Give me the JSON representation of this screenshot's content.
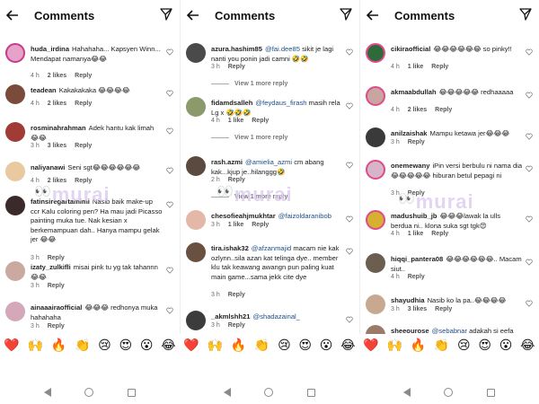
{
  "header": {
    "title": "Comments"
  },
  "watermark": "murai",
  "panels": [
    {
      "comments": [
        {
          "user": "huda_irdina",
          "text": "Hahahaha... Kapsyen Winn... Mendapat namanya😂😂",
          "time": "4 h",
          "likes": "2 likes",
          "reply": "Reply"
        },
        {
          "user": "teadean",
          "text": "Kakakakaka 😂😂😂😂",
          "time": "4 h",
          "likes": "2 likes",
          "reply": "Reply"
        },
        {
          "user": "rosminahrahman",
          "text": "Adek hantu kak limah 😂😂",
          "time": "3 h",
          "likes": "3 likes",
          "reply": "Reply"
        },
        {
          "user": "naliyanawi",
          "text": "Seni sgt😂😂😂😂😂😂",
          "time": "4 h",
          "likes": "2 likes",
          "reply": "Reply"
        },
        {
          "user": "fatinsiregartamimi",
          "text": "Nasib baik make-up ccr Kalu coloring pen? Ha mau jadi Picasso painting muka tue. Nak kesian x berkemampuan dah.. Hanya mampu gelak jer 😂😂",
          "time": "3 h",
          "likes": "",
          "reply": "Reply"
        },
        {
          "user": "izaty_zulkifli",
          "text": "misai pink tu yg tak tahannn😂😂",
          "time": "3 h",
          "likes": "",
          "reply": "Reply"
        },
        {
          "user": "ainaaairaofficial",
          "text": "😂😂😂 redhonya muka hahahaha",
          "time": "3 h",
          "likes": "",
          "reply": "Reply"
        }
      ]
    },
    {
      "comments": [
        {
          "user": "azura.hashim85",
          "mention": "@fai.dee85",
          "text": "sikit je lagi nanti you ponin jadi camni 🤣🤣",
          "time": "3 h",
          "likes": "",
          "reply": "Reply",
          "view_more": "View 1 more reply"
        },
        {
          "user": "fidamdsalleh",
          "mention": "@feydaus_firash",
          "text": "masih rela Lg x 🤣🤣🤣",
          "time": "4 h",
          "likes": "1 like",
          "reply": "Reply",
          "view_more": "View 1 more reply"
        },
        {
          "user": "rash.azmi",
          "mention": "@amielia_azmi",
          "text": "cm abang kak...kjup je..hilanggg🤣",
          "time": "2 h",
          "likes": "",
          "reply": "Reply",
          "view_more": "View 1 more reply"
        },
        {
          "user": "chesofieahjmukhtar",
          "mention": "@faizoldaranibob",
          "text": "",
          "time": "3 h",
          "likes": "1 like",
          "reply": "Reply"
        },
        {
          "user": "tira.ishak32",
          "mention": "@afzanmajid",
          "text": "macam nie kak ozlynn..sila azan kat telinga dye.. member klu tak keawang awangn pun paling kuat main game...sama jekk cite dye",
          "time": "3 h",
          "likes": "",
          "reply": "Reply"
        },
        {
          "user": "_akmlshh21",
          "mention": "@shadazainal_",
          "text": "",
          "time": "3 h",
          "likes": "",
          "reply": "Reply"
        }
      ]
    },
    {
      "comments": [
        {
          "user": "cikiraofficial",
          "text": "😂😂😂😂😂😂 so pinky!!",
          "time": "4 h",
          "likes": "1 like",
          "reply": "Reply"
        },
        {
          "user": "akmaabdullah",
          "text": "😂😂😂😂😂 redhaaaaa",
          "time": "4 h",
          "likes": "2 likes",
          "reply": "Reply"
        },
        {
          "user": "anilzaishak",
          "text": "Mampu ketawa jer😂😂😂",
          "time": "3 h",
          "likes": "",
          "reply": "Reply"
        },
        {
          "user": "onemewany",
          "text": "iPin versi berbulu ni nama dia 😂😂😂😂😂 hiburan betul pepagi ni",
          "time": "3 h",
          "likes": "",
          "reply": "Reply"
        },
        {
          "user": "madushuib_jb",
          "text": "😂😂😂lawak la ulls berdua ni.. klona suka sgt tgk😍",
          "time": "4 h",
          "likes": "1 like",
          "reply": "Reply"
        },
        {
          "user": "hiqqi_pantera08",
          "text": "😂😂😂😂😂😂.. Macam siut..",
          "time": "4 h",
          "likes": "",
          "reply": "Reply"
        },
        {
          "user": "shayudhia",
          "text": "Nasib ko la pa..😂😂😂😂",
          "time": "3 h",
          "likes": "3 likes",
          "reply": "Reply"
        },
        {
          "user": "sheeourose",
          "mention": "@sebabnar",
          "text": "adakah si eefa",
          "time": "",
          "likes": "",
          "reply": ""
        }
      ]
    }
  ],
  "emoji_bar": [
    "❤️",
    "🙌",
    "🔥",
    "👏",
    "😢",
    "😍",
    "😮",
    "😂"
  ],
  "colors": {
    "accent": "#1d4f8a",
    "meta": "#6b6b6b",
    "watermark": "#d9c7ee"
  }
}
